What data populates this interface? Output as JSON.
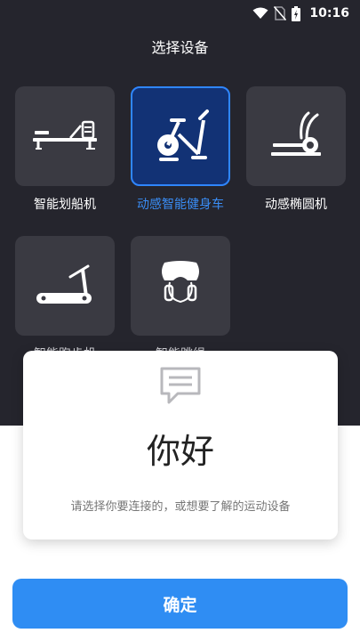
{
  "status_bar": {
    "time": "10:16",
    "icons": [
      "wifi-icon",
      "no-sim-icon",
      "battery-icon"
    ]
  },
  "page": {
    "title": "选择设备"
  },
  "devices": [
    {
      "label": "智能划船机",
      "icon": "rowing-machine-icon",
      "selected": false
    },
    {
      "label": "动感智能健身车",
      "icon": "exercise-bike-icon",
      "selected": true
    },
    {
      "label": "动感椭圆机",
      "icon": "elliptical-machine-icon",
      "selected": false
    },
    {
      "label": "智能跑步机",
      "icon": "treadmill-icon",
      "selected": false
    },
    {
      "label": "智能跳绳",
      "icon": "jump-rope-icon",
      "selected": false
    }
  ],
  "dialog": {
    "icon": "chat-message-icon",
    "greeting": "你好",
    "message": "请选择你要连接的，或想要了解的运动设备"
  },
  "confirm_button": {
    "label": "确定"
  },
  "colors": {
    "background_dark": "#25252d",
    "tile": "#3a3a42",
    "tile_selected": "#123275",
    "accent": "#2f8df3",
    "selected_label": "#3a8df5"
  }
}
